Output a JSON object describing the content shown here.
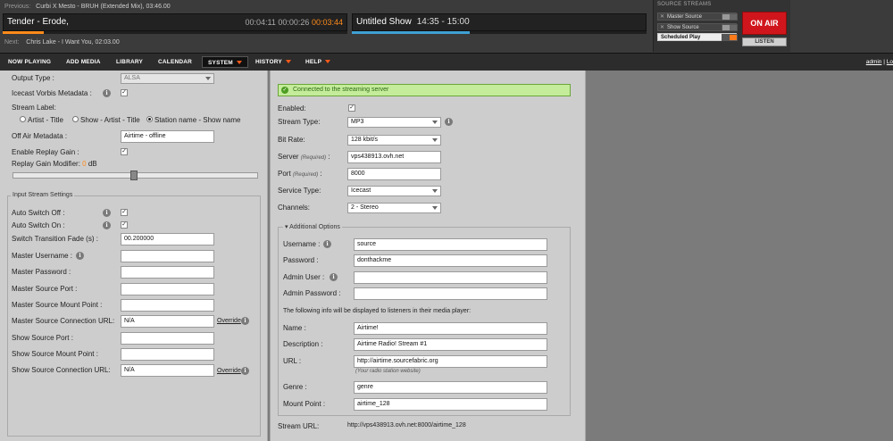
{
  "player": {
    "previous_label": "Previous:",
    "previous_track": "Curbi X Mesto - BRUH (Extended Mix), 03:46.00",
    "current_title": "Tender - Erode,",
    "elapsed": "00:04:11",
    "position": "00:00:26",
    "remaining": "00:03:44",
    "track_progress": 0.12,
    "next_label": "Next:",
    "next_track": "Chris Lake - I Want You, 02:03.00",
    "show_name": "Untitled Show",
    "show_time": "14:35 - 15:00",
    "show_progress": 0.4
  },
  "sources": {
    "header": "SOURCE STREAMS",
    "master": "Master Source",
    "show": "Show Source",
    "scheduled": "Scheduled Play",
    "on_air": "ON AIR",
    "listen": "LISTEN"
  },
  "nav": {
    "now_playing": "NOW PLAYING",
    "add_media": "ADD MEDIA",
    "library": "LIBRARY",
    "calendar": "CALENDAR",
    "system": "SYSTEM",
    "history": "HISTORY",
    "help": "HELP",
    "user": "admin",
    "separator": "|",
    "logout": "Lo"
  },
  "left": {
    "output_type_label": "Output Type :",
    "output_type_value": "ALSA",
    "icecast_vorbis_label": "Icecast Vorbis Metadata :",
    "stream_label_label": "Stream Label:",
    "radio_artist_title": "Artist - Title",
    "radio_show_artist_title": "Show - Artist - Title",
    "radio_station_show": "Station name - Show name",
    "off_air_label": "Off Air Metadata :",
    "off_air_value": "Airtime - offline",
    "replay_gain_label": "Enable Replay Gain :",
    "replay_gain_modifier_label": "Replay Gain Modifier:",
    "replay_gain_value": "0",
    "replay_gain_unit": "dB",
    "input_legend": "Input Stream Settings",
    "auto_switch_off": "Auto Switch Off :",
    "auto_switch_on": "Auto Switch On :",
    "switch_fade_label": "Switch Transition Fade (s) :",
    "switch_fade_value": "00.200000",
    "master_username": "Master Username :",
    "master_password": "Master Password :",
    "master_port": "Master Source Port :",
    "master_mount": "Master Source Mount Point :",
    "master_url_label": "Master Source Connection URL:",
    "master_url_value": "N/A",
    "override": "Override",
    "show_port": "Show Source Port :",
    "show_mount": "Show Source Mount Point :",
    "show_url_label": "Show Source Connection URL:",
    "show_url_value": "N/A"
  },
  "stream": {
    "success": "Connected to the streaming server",
    "enabled_label": "Enabled:",
    "stream_type_label": "Stream Type:",
    "stream_type_value": "MP3",
    "bitrate_label": "Bit Rate:",
    "bitrate_value": "128 kbit/s",
    "server_label": "Server",
    "required": "(Required)",
    "server_value": "vps438913.ovh.net",
    "port_label": "Port",
    "port_value": "8000",
    "service_label": "Service Type:",
    "service_value": "Icecast",
    "channels_label": "Channels:",
    "channels_value": "2 - Stereo",
    "additional_legend": "Additional Options",
    "username_label": "Username :",
    "username_value": "source",
    "password_label": "Password :",
    "password_value": "donthackme",
    "admin_user_label": "Admin User :",
    "admin_password_label": "Admin Password :",
    "listeners_info": "The following info will be displayed to listeners in their media player:",
    "name_label": "Name :",
    "name_value": "Airtime!",
    "description_label": "Description :",
    "description_value": "Airtime Radio! Stream #1",
    "url_label": "URL :",
    "url_value": "http://airtime.sourcefabric.org",
    "url_note": "(Your radio station website)",
    "genre_label": "Genre :",
    "genre_value": "genre",
    "mount_label": "Mount Point :",
    "mount_value": "airtime_128",
    "stream_url_label": "Stream URL:",
    "stream_url_value": "http://vps438913.ovh.net:8000/airtime_128"
  }
}
